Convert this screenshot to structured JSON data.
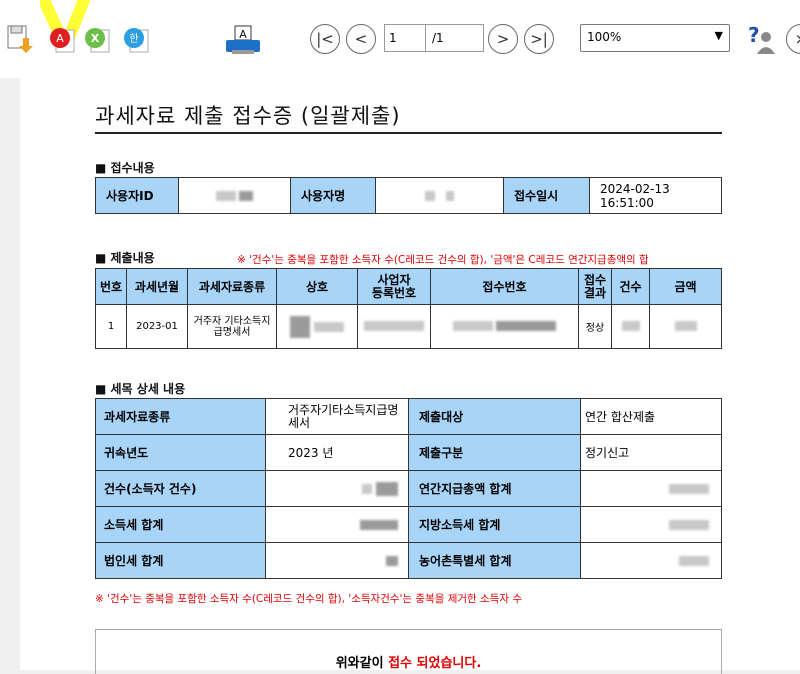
{
  "toolbar": {
    "icons": [
      "save-download-icon",
      "pdf-icon",
      "excel-icon",
      "hwp-icon",
      "print-icon"
    ],
    "page_current": "1",
    "page_total": "/1",
    "zoom_value": "100%",
    "nav": {
      "first": "|<",
      "prev": "<",
      "next": ">",
      "last": ">|"
    },
    "colors": {
      "accent": "#a8d4f8",
      "highlight": "#ffff00",
      "red": "#e00000"
    }
  },
  "doc": {
    "title": "과세자료 제출 접수증 (일괄제출)",
    "receipt_section": "■ 접수내용",
    "receipt": {
      "user_id_label": "사용자ID",
      "user_name_label": "사용자명",
      "date_label": "접수일시",
      "date_value": "2024-02-13",
      "time_value": "16:51:00"
    },
    "submission_section": "■ 제출내용",
    "submission_note": "※ '건수'는 중복을 포함한 소득자 수(C레코드 건수의 합), '금액'은 C레코드 연간지급총액의 합",
    "submission_headers": [
      "번호",
      "과세년월",
      "과세자료종류",
      "상호",
      "사업자\n등록번호",
      "접수번호",
      "접수\n결과",
      "건수",
      "금액"
    ],
    "submission_row": {
      "no": "1",
      "period": "2023-01",
      "type": "거주자 기타소득지급명세서",
      "result": "정상"
    },
    "detail_section": "■ 세목 상세 내용",
    "detail": {
      "type_label": "과세자료종류",
      "type_value": "거주자기타소득지급명세서",
      "target_label": "제출대상",
      "target_value": "연간 합산제출",
      "year_label": "귀속년도",
      "year_value": "2023 년",
      "kind_label": "제출구분",
      "kind_value": "정기신고",
      "count_label": "건수(소득자 건수)",
      "total_pay_label": "연간지급총액 합계",
      "income_tax_label": "소득세 합계",
      "local_tax_label": "지방소득세 합계",
      "corp_tax_label": "법인세 합계",
      "rural_tax_label": "농어촌특별세 합계"
    },
    "detail_note": "※ '건수'는 중복을 포함한 소득자 수(C레코드 건수의 합), '소득자건수'는 중복을 제거한 소득자 수",
    "confirm_prefix": "위와같이",
    "confirm_emph": "접수 되었습니다."
  }
}
